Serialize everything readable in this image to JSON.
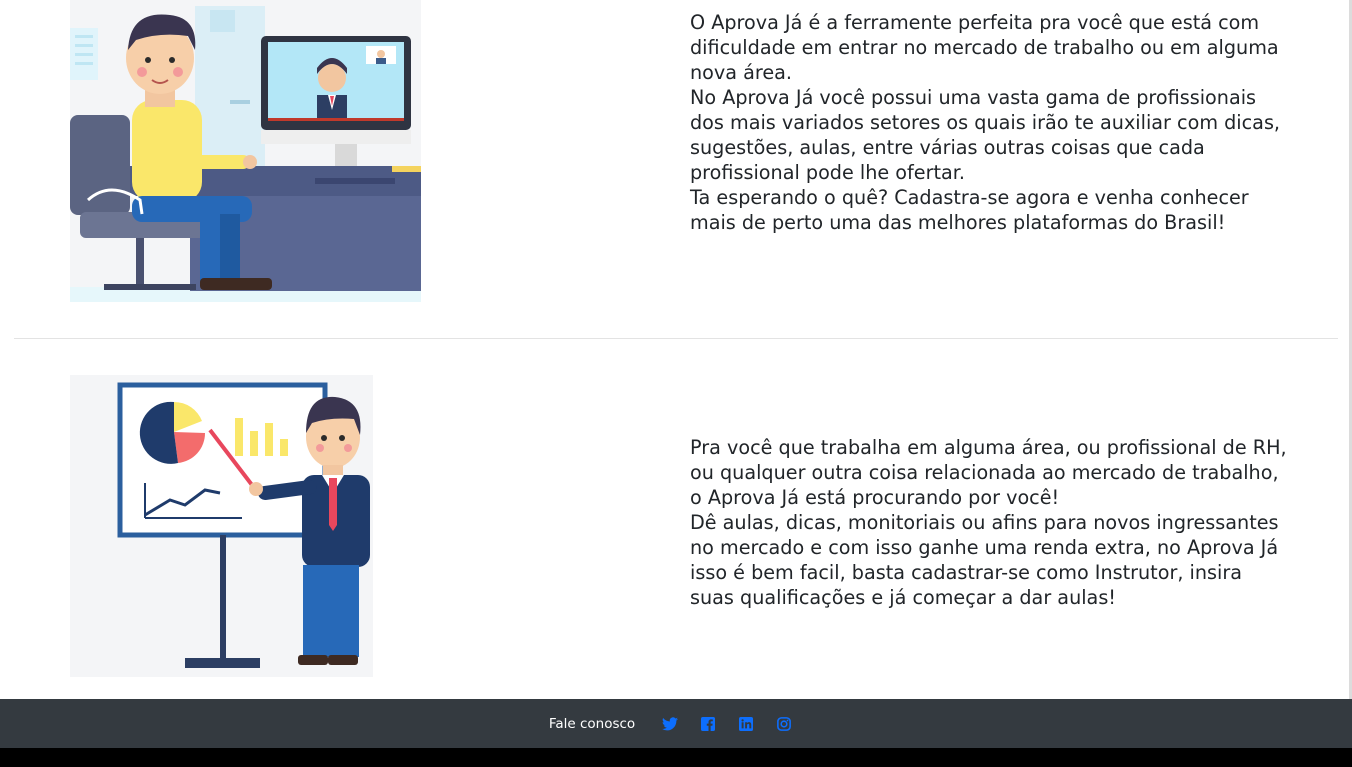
{
  "section1": {
    "illustration_icon": "man-at-desk-video-call-illustration",
    "paragraphs": [
      "O Aprova Já é a ferramente perfeita pra você que está com dificuldade em entrar no mercado de trabalho ou em alguma nova área.",
      "No Aprova Já você possui uma vasta gama de profissionais dos mais variados setores os quais irão te auxiliar com dicas, sugestões, aulas, entre várias outras coisas que cada profissional pode lhe ofertar.",
      "Ta esperando o quê? Cadastra-se agora e venha conhecer mais de perto uma das melhores plataformas do Brasil!"
    ]
  },
  "section2": {
    "illustration_icon": "presenter-with-whiteboard-charts-illustration",
    "paragraphs": [
      "Pra você que trabalha em alguma área, ou profissional de RH, ou qualquer outra coisa relacionada ao mercado de trabalho, o Aprova Já está procurando por você!",
      "Dê aulas, dicas, monitoriais ou afins para novos ingressantes no mercado e com isso ganhe uma renda extra, no Aprova Já isso é bem facil, basta cadastrar-se como Instrutor, insira suas qualificações e já começar a dar aulas!"
    ]
  },
  "footer": {
    "label": "Fale conosco",
    "icons": [
      "twitter-icon",
      "facebook-icon",
      "linkedin-icon",
      "instagram-icon"
    ],
    "icon_color": "#0d6efd",
    "background": "#343a40"
  }
}
